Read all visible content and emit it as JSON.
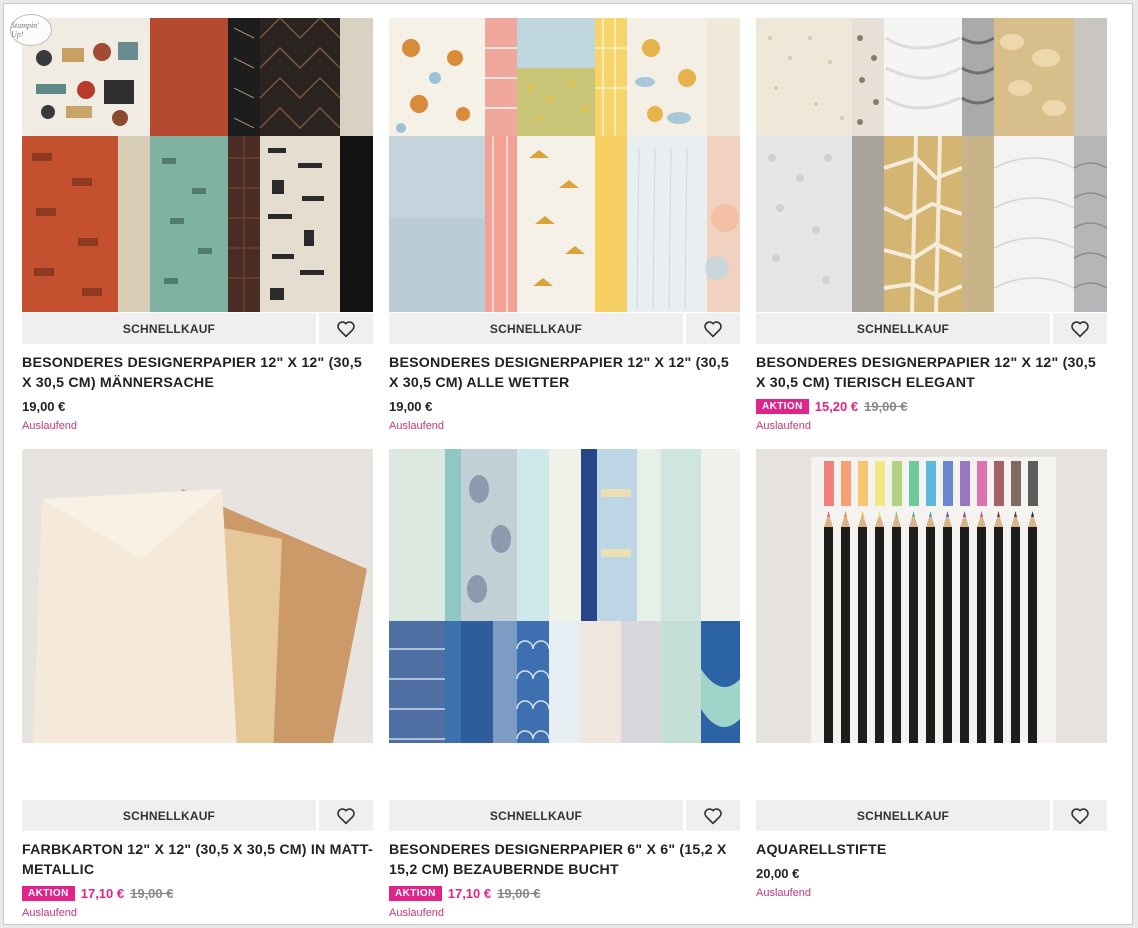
{
  "logo_text": "Stampin' Up!",
  "products": [
    {
      "name": "card-maennersache",
      "quick_label": "SCHNELLKAUF",
      "title": "BESONDERES DESIGNERPAPIER 12\" X 12\" (30,5 X 30,5 CM) MÄNNERSACHE",
      "price": "19,00 €",
      "status": "Auslaufend"
    },
    {
      "name": "card-alle-wetter",
      "quick_label": "SCHNELLKAUF",
      "title": "BESONDERES DESIGNERPAPIER 12\" X 12\" (30,5 X 30,5 CM) ALLE WETTER",
      "price": "19,00 €",
      "status": "Auslaufend"
    },
    {
      "name": "card-tierisch-elegant",
      "quick_label": "SCHNELLKAUF",
      "title": "BESONDERES DESIGNERPAPIER 12\" X 12\" (30,5 X 30,5 CM) TIERISCH ELEGANT",
      "badge": "AKTION",
      "sale_price": "15,20 €",
      "old_price": "19,00 €",
      "status": "Auslaufend"
    },
    {
      "name": "card-matt-metallic",
      "quick_label": "SCHNELLKAUF",
      "title": "FARBKARTON 12\" X 12\" (30,5 X 30,5 CM) IN MATT-METALLIC",
      "badge": "AKTION",
      "sale_price": "17,10 €",
      "old_price": "19,00 €",
      "status": "Auslaufend"
    },
    {
      "name": "card-bezaubernde-bucht",
      "quick_label": "SCHNELLKAUF",
      "title": "BESONDERES DESIGNERPAPIER 6\" X 6\" (15,2 X 15,2 CM) BEZAUBERNDE BUCHT",
      "badge": "AKTION",
      "sale_price": "17,10 €",
      "old_price": "19,00 €",
      "status": "Auslaufend"
    },
    {
      "name": "card-aquarellstifte",
      "quick_label": "SCHNELLKAUF",
      "title": "AQUARELLSTIFTE",
      "price": "20,00 €",
      "status": "Auslaufend"
    }
  ],
  "colors": {
    "accent": "#e0248a",
    "status_text": "#c4387b",
    "button_bg": "#efefef"
  },
  "icons": {
    "favorite": "heart-icon"
  }
}
